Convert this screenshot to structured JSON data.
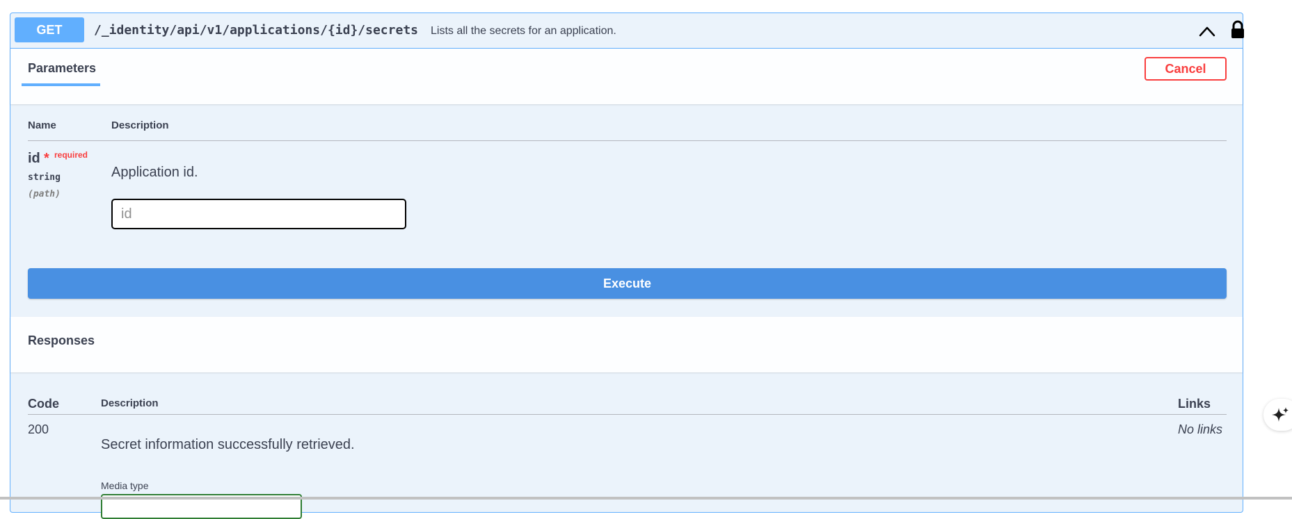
{
  "operation": {
    "method": "GET",
    "path": "/_identity/api/v1/applications/{id}/secrets",
    "summary": "Lists all the secrets for an application."
  },
  "parameters_section": {
    "tab_label": "Parameters",
    "cancel_label": "Cancel",
    "columns": {
      "name": "Name",
      "description": "Description"
    },
    "params": [
      {
        "name": "id",
        "required_marker": "*",
        "required_label": "required",
        "type": "string",
        "in": "(path)",
        "description": "Application id.",
        "placeholder": "id",
        "value": ""
      }
    ],
    "execute_label": "Execute"
  },
  "responses_section": {
    "title": "Responses",
    "columns": {
      "code": "Code",
      "description": "Description",
      "links": "Links"
    },
    "rows": [
      {
        "code": "200",
        "description": "Secret information successfully retrieved.",
        "links": "No links",
        "media_type_label": "Media type"
      }
    ]
  },
  "icons": {
    "collapse": "chevron-up-icon",
    "auth": "lock-icon",
    "assistant": "sparkle-icon"
  },
  "colors": {
    "get_accent": "#61affe",
    "execute": "#4990e2",
    "cancel": "#f93e3e",
    "panel_bg": "#ebf3fb"
  }
}
